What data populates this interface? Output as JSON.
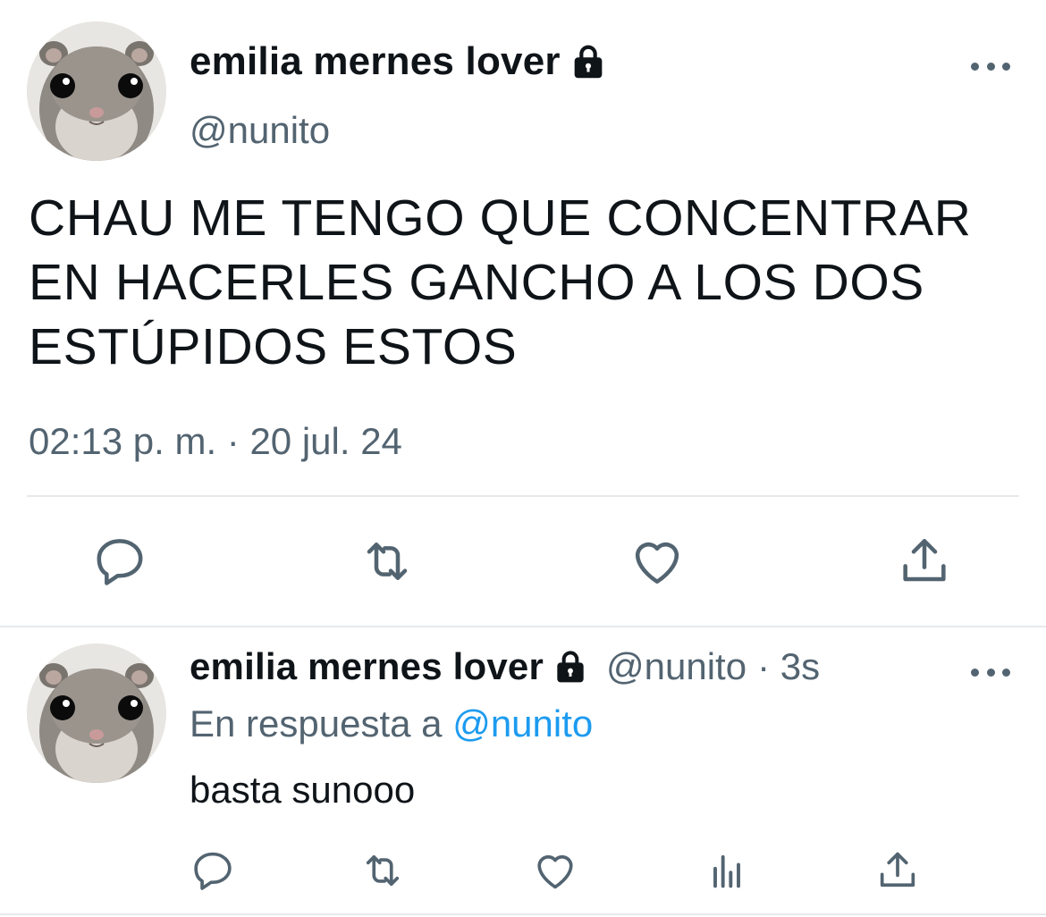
{
  "main_tweet": {
    "display_name": "emilia mernes lover",
    "handle": "@nunito",
    "text": "CHAU ME TENGO QUE CONCENTRAR EN HACERLES GANCHO A LOS DOS ESTÚPIDOS ESTOS",
    "timestamp": "02:13 p. m. · 20 jul. 24",
    "protected_icon": "lock-icon",
    "actions": [
      "reply-icon",
      "retweet-icon",
      "like-icon",
      "share-icon"
    ]
  },
  "reply_tweet": {
    "display_name": "emilia mernes lover",
    "handle": "@nunito",
    "age": "· 3s",
    "reply_prefix": "En respuesta a",
    "reply_mention": "@nunito",
    "text": "basta sunooo",
    "protected_icon": "lock-icon",
    "actions": [
      "reply-icon",
      "retweet-icon",
      "like-icon",
      "analytics-icon",
      "share-icon"
    ]
  },
  "colors": {
    "text_primary": "#0f1419",
    "text_secondary": "#536471",
    "link": "#1d9bf0",
    "divider": "#e6e9ec"
  }
}
